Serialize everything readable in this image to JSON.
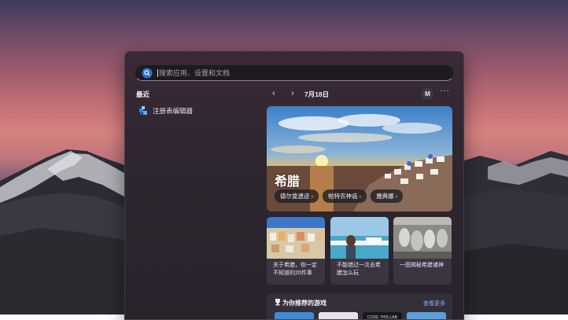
{
  "search": {
    "placeholder": "搜索应用、设置和文档"
  },
  "recent": {
    "title": "最近",
    "items": [
      {
        "label": "注册表编辑器",
        "icon": "registry-editor-icon"
      }
    ]
  },
  "header": {
    "date": "7月18日",
    "avatar_initial": "M",
    "more_label": "···"
  },
  "hero": {
    "title": "希腊",
    "chips": [
      "德尔斐遗迹 ›",
      "帕特农神庙 ›",
      "雅典娜 ›"
    ]
  },
  "cards": [
    {
      "text": "关于希腊，你一定不知道的20件事"
    },
    {
      "text": "不能错过一次去希腊怎么玩"
    },
    {
      "text": "一图揭秘希腊诸神"
    }
  ],
  "games": {
    "title": "为你推荐的游戏",
    "see_more": "查看更多",
    "icon": "trophy-icon",
    "tile_text": "CODE THIS LAB"
  },
  "colors": {
    "accent": "#7fb2ff",
    "panel": "#2e2630"
  }
}
